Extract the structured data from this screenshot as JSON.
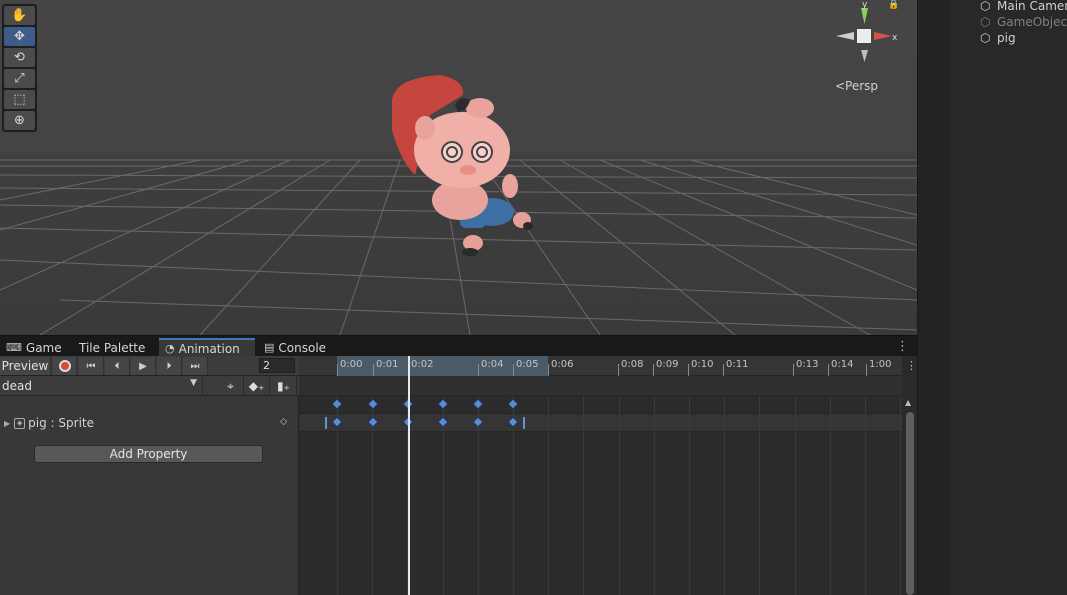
{
  "scene": {
    "tools": [
      {
        "name": "hand-tool",
        "icon": "hand-icon",
        "glyph": "✋",
        "active": false
      },
      {
        "name": "move-tool",
        "icon": "move-icon",
        "glyph": "✥",
        "active": true
      },
      {
        "name": "rotate-tool",
        "icon": "rotate-icon",
        "glyph": "⟲",
        "active": false
      },
      {
        "name": "scale-tool",
        "icon": "scale-icon",
        "glyph": "⤢",
        "active": false
      },
      {
        "name": "rect-tool",
        "icon": "rect-icon",
        "glyph": "⬚",
        "active": false
      },
      {
        "name": "transform-tool",
        "icon": "transform-icon",
        "glyph": "⊕",
        "active": false
      }
    ],
    "gizmo": {
      "y_label": "y",
      "x_label": "x"
    },
    "persp_label": "<Persp"
  },
  "hierarchy": {
    "items": [
      {
        "label": "Main Camera",
        "dim": false
      },
      {
        "label": "GameObject",
        "dim": true
      },
      {
        "label": "pig",
        "dim": false
      }
    ]
  },
  "tabs": [
    {
      "label": "Game",
      "icon": "gamepad-icon",
      "active": false
    },
    {
      "label": "Tile Palette",
      "icon": "",
      "active": false
    },
    {
      "label": "Animation",
      "icon": "clock-icon",
      "active": true
    },
    {
      "label": "Console",
      "icon": "console-icon",
      "active": false
    }
  ],
  "animation": {
    "preview_label": "Preview",
    "frame_value": "2",
    "clip_name": "dead",
    "property_label": "pig : Sprite",
    "add_property_label": "Add Property",
    "ruler_labels": [
      "0:00",
      "0:01",
      "0:02",
      "0:04",
      "0:05",
      "0:06",
      "0:08",
      "0:09",
      "0:10",
      "0:11",
      "0:13",
      "0:14",
      "1:00"
    ],
    "keyframe_times": [
      "0:00",
      "0:01",
      "0:02",
      "0:04",
      "0:05",
      "0:06"
    ],
    "current_frame": 2
  },
  "colors": {
    "accent": "#3a79bb",
    "keyframe": "#5c8bd6",
    "record": "#d84a3a"
  }
}
